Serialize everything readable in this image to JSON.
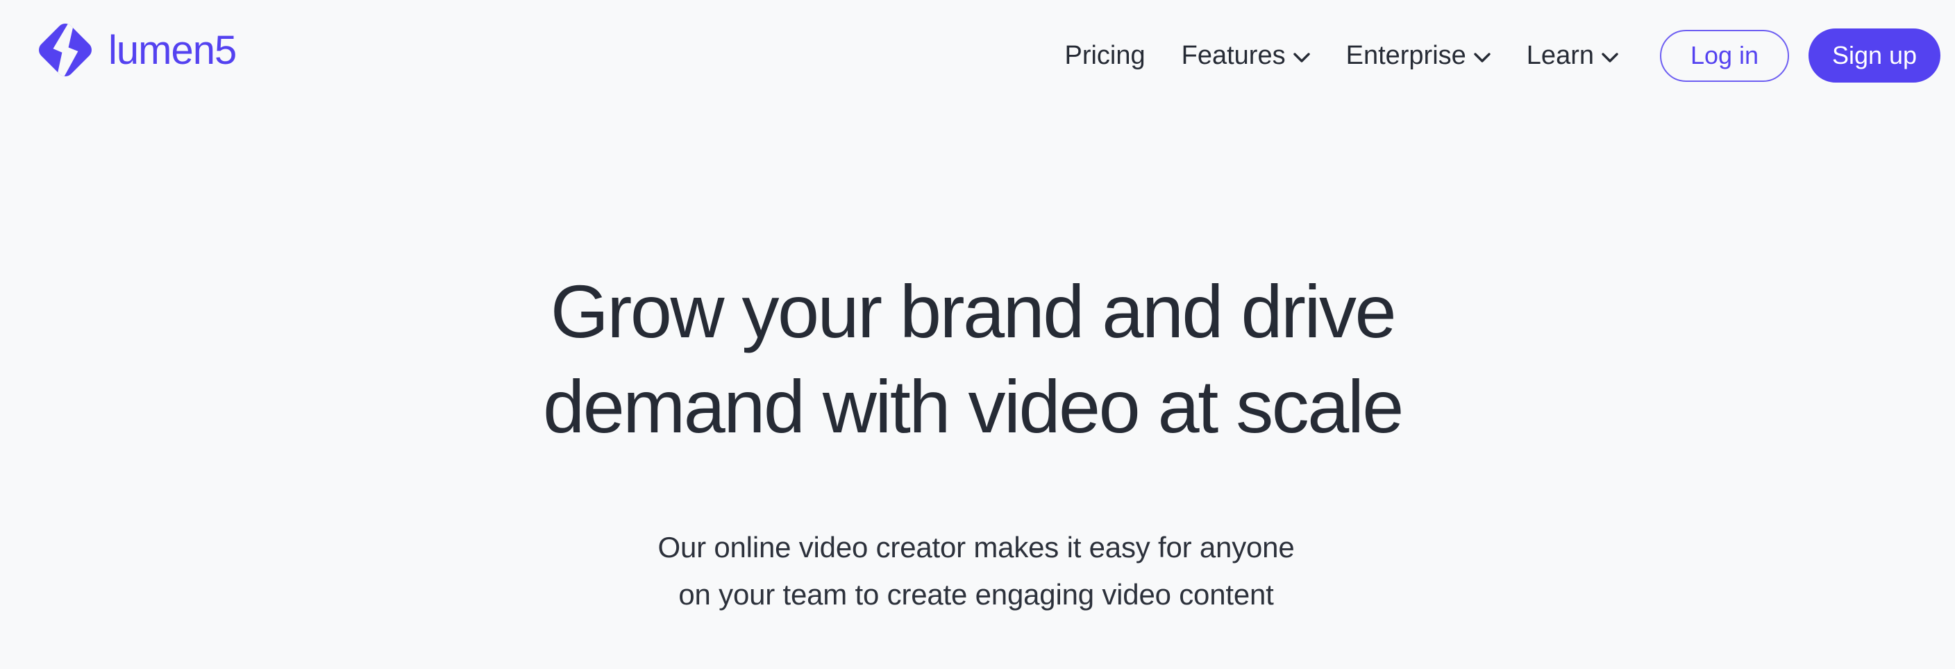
{
  "colors": {
    "brand_purple": "#5442f0",
    "login_border": "#6d5ef2",
    "page_background": "#f8f9fa",
    "heading_text": "#262b35",
    "body_text": "#2c313b"
  },
  "header": {
    "logo": {
      "mark_icon": "lumen5-diamond-bolt-logo-icon",
      "wordmark": "lumen5"
    },
    "nav_items": [
      {
        "label": "Pricing",
        "has_dropdown": false,
        "dropdown_icon": ""
      },
      {
        "label": "Features",
        "has_dropdown": true,
        "dropdown_icon": "chevron-down-icon"
      },
      {
        "label": "Enterprise",
        "has_dropdown": true,
        "dropdown_icon": "chevron-down-icon"
      },
      {
        "label": "Learn",
        "has_dropdown": true,
        "dropdown_icon": "chevron-down-icon"
      }
    ],
    "login_label": "Log in",
    "signup_label": "Sign up"
  },
  "hero": {
    "title_line_1": "Grow your brand and drive",
    "title_line_2": "demand with video at scale",
    "subtitle_line_1": "Our online video creator makes it easy for anyone",
    "subtitle_line_2": "on your team to create engaging video content"
  }
}
